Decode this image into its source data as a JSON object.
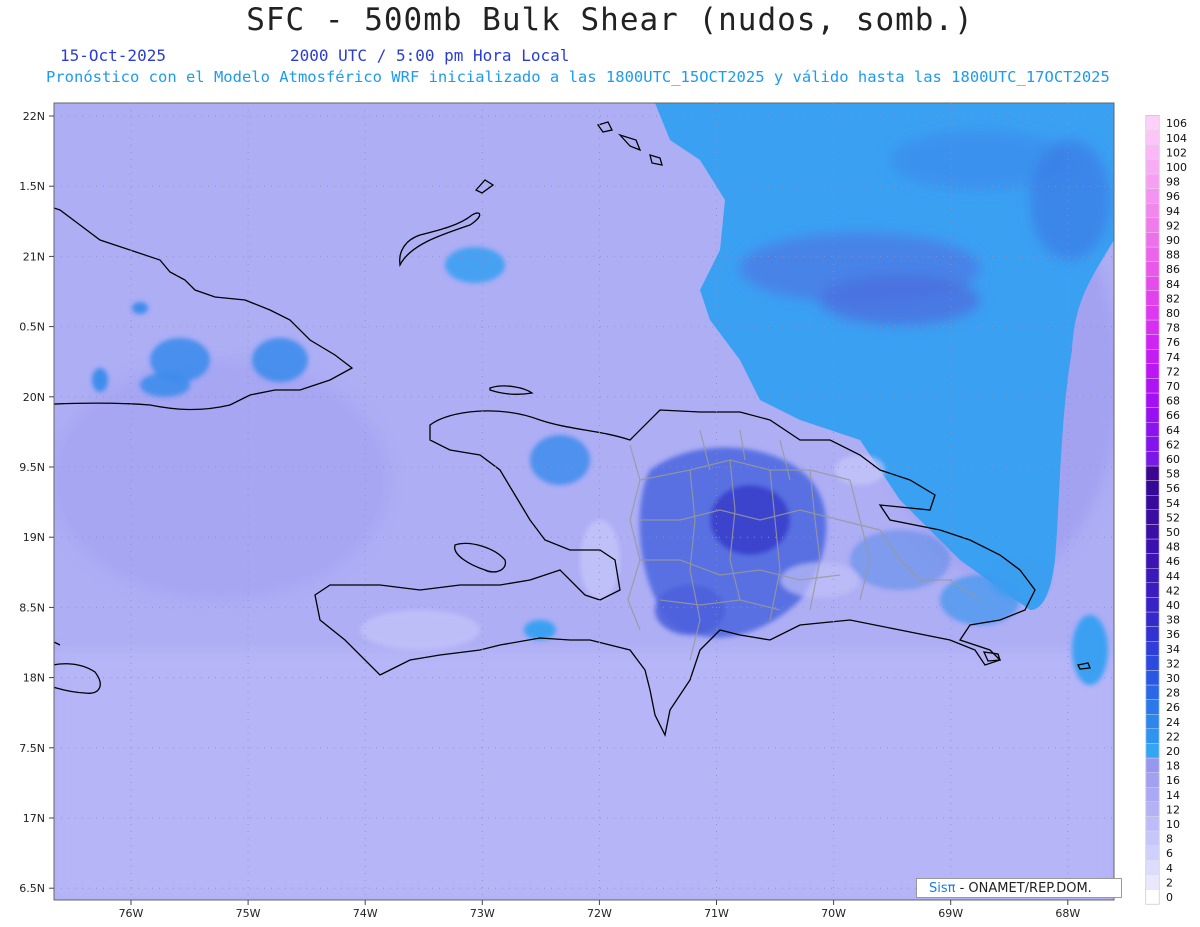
{
  "header": {
    "title": "SFC - 500mb Bulk Shear (nudos, somb.)",
    "date": "15-Oct-2025",
    "time": "2000 UTC / 5:00 pm Hora Local",
    "model_note": "Pronóstico con el Modelo Atmosférico WRF inicializado a las 1800UTC_15OCT2025 y válido hasta las  1800UTC_17OCT2025"
  },
  "credit": {
    "brand": "Sisπ",
    "org": "- ONAMET/REP.DOM."
  },
  "axes": {
    "lon_labels": [
      "76W",
      "75W",
      "74W",
      "73W",
      "72W",
      "71W",
      "70W",
      "69W",
      "68W"
    ],
    "lat_labels": [
      "22N",
      "1.5N",
      "21N",
      "0.5N",
      "20N",
      "9.5N",
      "19N",
      "8.5N",
      "18N",
      "7.5N",
      "17N",
      "6.5N"
    ]
  },
  "legend": {
    "levels": [
      "0",
      "2",
      "4",
      "6",
      "8",
      "10",
      "12",
      "14",
      "16",
      "18",
      "20",
      "22",
      "24",
      "26",
      "28",
      "30",
      "32",
      "34",
      "36",
      "38",
      "40",
      "42",
      "44",
      "46",
      "48",
      "50",
      "52",
      "54",
      "56",
      "58",
      "60",
      "62",
      "64",
      "66",
      "68",
      "70",
      "72",
      "74",
      "76",
      "78",
      "80",
      "82",
      "84",
      "86",
      "88",
      "90",
      "92",
      "94",
      "96",
      "98",
      "100",
      "102",
      "104",
      "106"
    ],
    "colors": [
      "#ffffff",
      "#e8e8ff",
      "#dcdcff",
      "#d0d0fc",
      "#c6c6fb",
      "#bdbcf8",
      "#b3b2f5",
      "#aaa9f3",
      "#a1a0f1",
      "#9897ef",
      "#34a4f4",
      "#2f94f1",
      "#2c86ee",
      "#2a78ea",
      "#2a68e6",
      "#2a58e2",
      "#2c4ade",
      "#2f3ed8",
      "#3232d2",
      "#3528cc",
      "#3822c6",
      "#3a1cc0",
      "#3b18ba",
      "#3c14b4",
      "#3c10ae",
      "#3c0ea8",
      "#3a0ca2",
      "#380a9c",
      "#360896",
      "#3c0690",
      "#7a18ea",
      "#8214ee",
      "#8c12f0",
      "#9810f2",
      "#a410f4",
      "#b012f4",
      "#bc16f4",
      "#c61cf4",
      "#d024f4",
      "#d82ef2",
      "#de38f0",
      "#e242ee",
      "#e64cec",
      "#ea58ea",
      "#ec64ea",
      "#ee70ea",
      "#f07cec",
      "#f288ee",
      "#f494f0",
      "#f6a0f2",
      "#f8acf4",
      "#fab8f6",
      "#fcc4f8",
      "#fdd0fa"
    ]
  }
}
